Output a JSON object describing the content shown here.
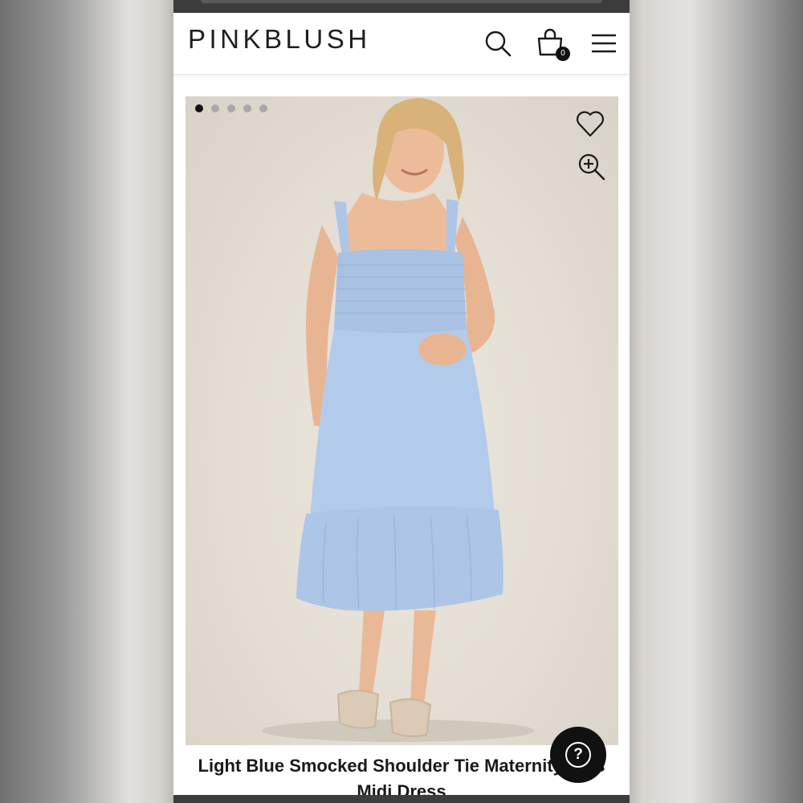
{
  "header": {
    "logo": "PINKBLUSH",
    "cart_count": "0",
    "search_icon": "search-icon",
    "cart_icon": "shopping-bag-icon",
    "menu_icon": "hamburger-menu-icon"
  },
  "gallery": {
    "slides": 5,
    "active_slide": 1,
    "favorite_icon": "heart-icon",
    "zoom_icon": "zoom-in-icon"
  },
  "product": {
    "title": "Light Blue Smocked Shoulder Tie Maternity Plus Midi Dress"
  },
  "help": {
    "label": "?",
    "icon": "help-icon"
  },
  "colors": {
    "brand_text": "#1f1f1f",
    "dress": "#aec6e6",
    "help_button": "#111111"
  }
}
